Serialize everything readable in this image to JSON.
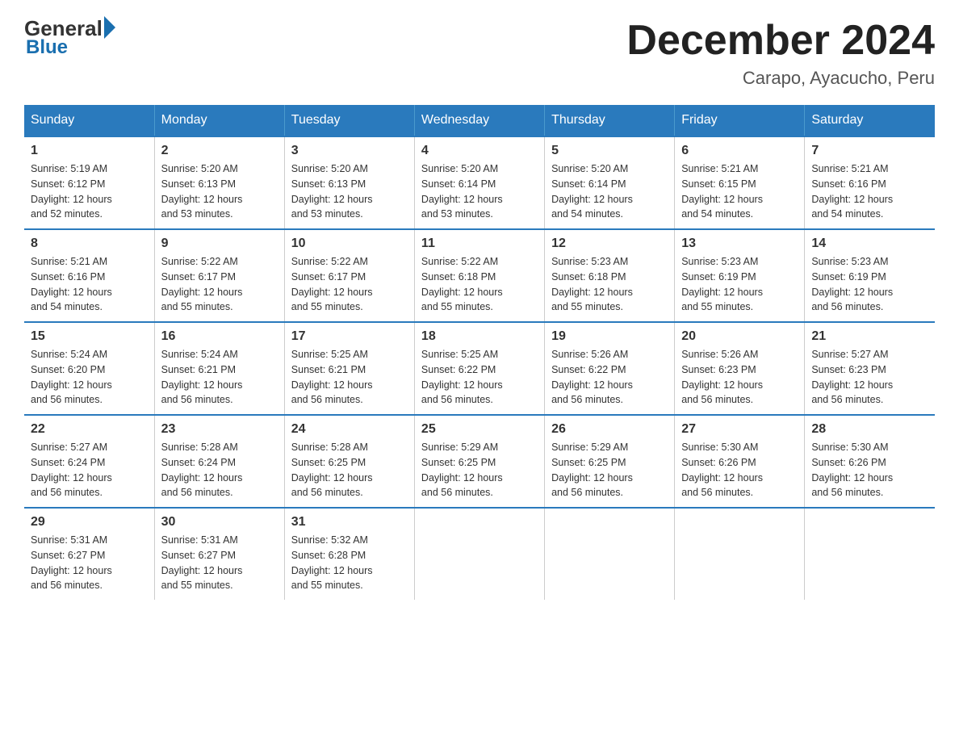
{
  "header": {
    "logo_general": "General",
    "logo_blue": "Blue",
    "month_title": "December 2024",
    "subtitle": "Carapo, Ayacucho, Peru"
  },
  "days_of_week": [
    "Sunday",
    "Monday",
    "Tuesday",
    "Wednesday",
    "Thursday",
    "Friday",
    "Saturday"
  ],
  "weeks": [
    [
      {
        "day": "1",
        "sunrise": "5:19 AM",
        "sunset": "6:12 PM",
        "daylight": "12 hours and 52 minutes."
      },
      {
        "day": "2",
        "sunrise": "5:20 AM",
        "sunset": "6:13 PM",
        "daylight": "12 hours and 53 minutes."
      },
      {
        "day": "3",
        "sunrise": "5:20 AM",
        "sunset": "6:13 PM",
        "daylight": "12 hours and 53 minutes."
      },
      {
        "day": "4",
        "sunrise": "5:20 AM",
        "sunset": "6:14 PM",
        "daylight": "12 hours and 53 minutes."
      },
      {
        "day": "5",
        "sunrise": "5:20 AM",
        "sunset": "6:14 PM",
        "daylight": "12 hours and 54 minutes."
      },
      {
        "day": "6",
        "sunrise": "5:21 AM",
        "sunset": "6:15 PM",
        "daylight": "12 hours and 54 minutes."
      },
      {
        "day": "7",
        "sunrise": "5:21 AM",
        "sunset": "6:16 PM",
        "daylight": "12 hours and 54 minutes."
      }
    ],
    [
      {
        "day": "8",
        "sunrise": "5:21 AM",
        "sunset": "6:16 PM",
        "daylight": "12 hours and 54 minutes."
      },
      {
        "day": "9",
        "sunrise": "5:22 AM",
        "sunset": "6:17 PM",
        "daylight": "12 hours and 55 minutes."
      },
      {
        "day": "10",
        "sunrise": "5:22 AM",
        "sunset": "6:17 PM",
        "daylight": "12 hours and 55 minutes."
      },
      {
        "day": "11",
        "sunrise": "5:22 AM",
        "sunset": "6:18 PM",
        "daylight": "12 hours and 55 minutes."
      },
      {
        "day": "12",
        "sunrise": "5:23 AM",
        "sunset": "6:18 PM",
        "daylight": "12 hours and 55 minutes."
      },
      {
        "day": "13",
        "sunrise": "5:23 AM",
        "sunset": "6:19 PM",
        "daylight": "12 hours and 55 minutes."
      },
      {
        "day": "14",
        "sunrise": "5:23 AM",
        "sunset": "6:19 PM",
        "daylight": "12 hours and 56 minutes."
      }
    ],
    [
      {
        "day": "15",
        "sunrise": "5:24 AM",
        "sunset": "6:20 PM",
        "daylight": "12 hours and 56 minutes."
      },
      {
        "day": "16",
        "sunrise": "5:24 AM",
        "sunset": "6:21 PM",
        "daylight": "12 hours and 56 minutes."
      },
      {
        "day": "17",
        "sunrise": "5:25 AM",
        "sunset": "6:21 PM",
        "daylight": "12 hours and 56 minutes."
      },
      {
        "day": "18",
        "sunrise": "5:25 AM",
        "sunset": "6:22 PM",
        "daylight": "12 hours and 56 minutes."
      },
      {
        "day": "19",
        "sunrise": "5:26 AM",
        "sunset": "6:22 PM",
        "daylight": "12 hours and 56 minutes."
      },
      {
        "day": "20",
        "sunrise": "5:26 AM",
        "sunset": "6:23 PM",
        "daylight": "12 hours and 56 minutes."
      },
      {
        "day": "21",
        "sunrise": "5:27 AM",
        "sunset": "6:23 PM",
        "daylight": "12 hours and 56 minutes."
      }
    ],
    [
      {
        "day": "22",
        "sunrise": "5:27 AM",
        "sunset": "6:24 PM",
        "daylight": "12 hours and 56 minutes."
      },
      {
        "day": "23",
        "sunrise": "5:28 AM",
        "sunset": "6:24 PM",
        "daylight": "12 hours and 56 minutes."
      },
      {
        "day": "24",
        "sunrise": "5:28 AM",
        "sunset": "6:25 PM",
        "daylight": "12 hours and 56 minutes."
      },
      {
        "day": "25",
        "sunrise": "5:29 AM",
        "sunset": "6:25 PM",
        "daylight": "12 hours and 56 minutes."
      },
      {
        "day": "26",
        "sunrise": "5:29 AM",
        "sunset": "6:25 PM",
        "daylight": "12 hours and 56 minutes."
      },
      {
        "day": "27",
        "sunrise": "5:30 AM",
        "sunset": "6:26 PM",
        "daylight": "12 hours and 56 minutes."
      },
      {
        "day": "28",
        "sunrise": "5:30 AM",
        "sunset": "6:26 PM",
        "daylight": "12 hours and 56 minutes."
      }
    ],
    [
      {
        "day": "29",
        "sunrise": "5:31 AM",
        "sunset": "6:27 PM",
        "daylight": "12 hours and 56 minutes."
      },
      {
        "day": "30",
        "sunrise": "5:31 AM",
        "sunset": "6:27 PM",
        "daylight": "12 hours and 55 minutes."
      },
      {
        "day": "31",
        "sunrise": "5:32 AM",
        "sunset": "6:28 PM",
        "daylight": "12 hours and 55 minutes."
      },
      null,
      null,
      null,
      null
    ]
  ],
  "labels": {
    "sunrise": "Sunrise:",
    "sunset": "Sunset:",
    "daylight": "Daylight:"
  }
}
